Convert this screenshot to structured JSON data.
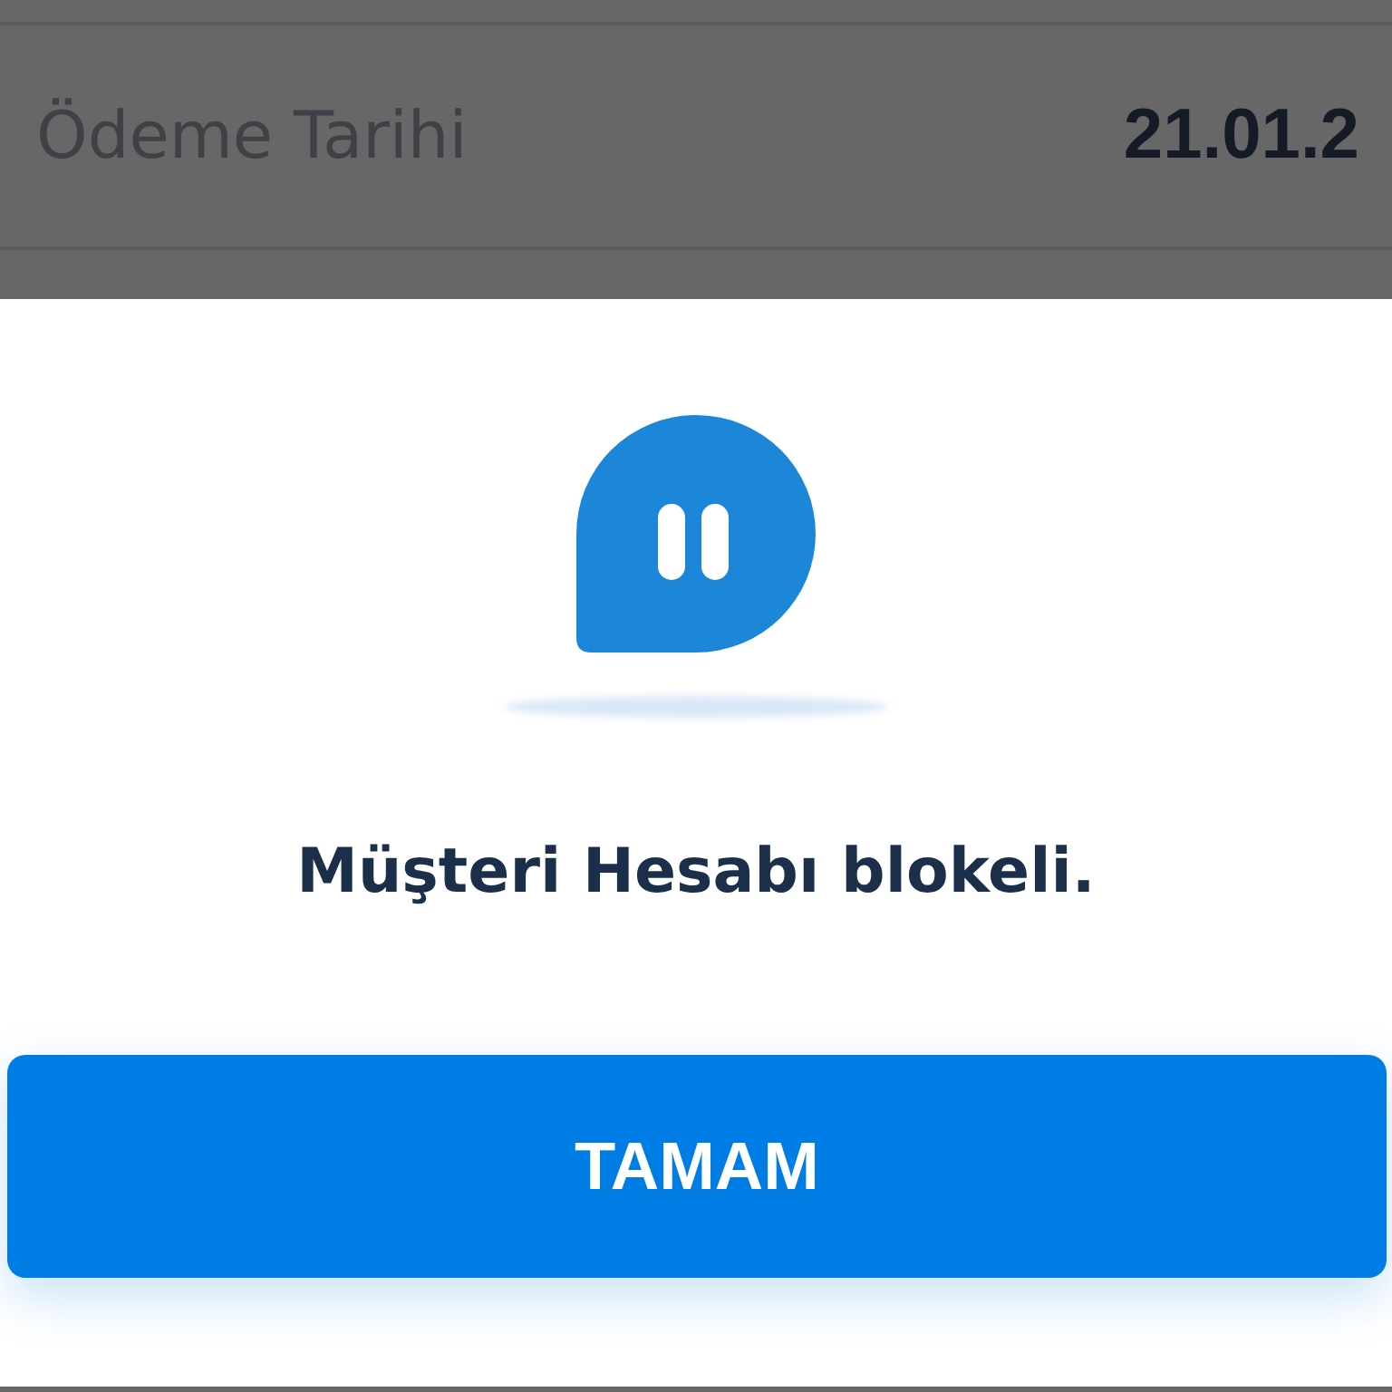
{
  "background_row": {
    "label": "Ödeme Tarihi",
    "value": "21.01.2"
  },
  "dialog": {
    "message": "Müşteri Hesabı blokeli.",
    "button": "TAMAM"
  }
}
